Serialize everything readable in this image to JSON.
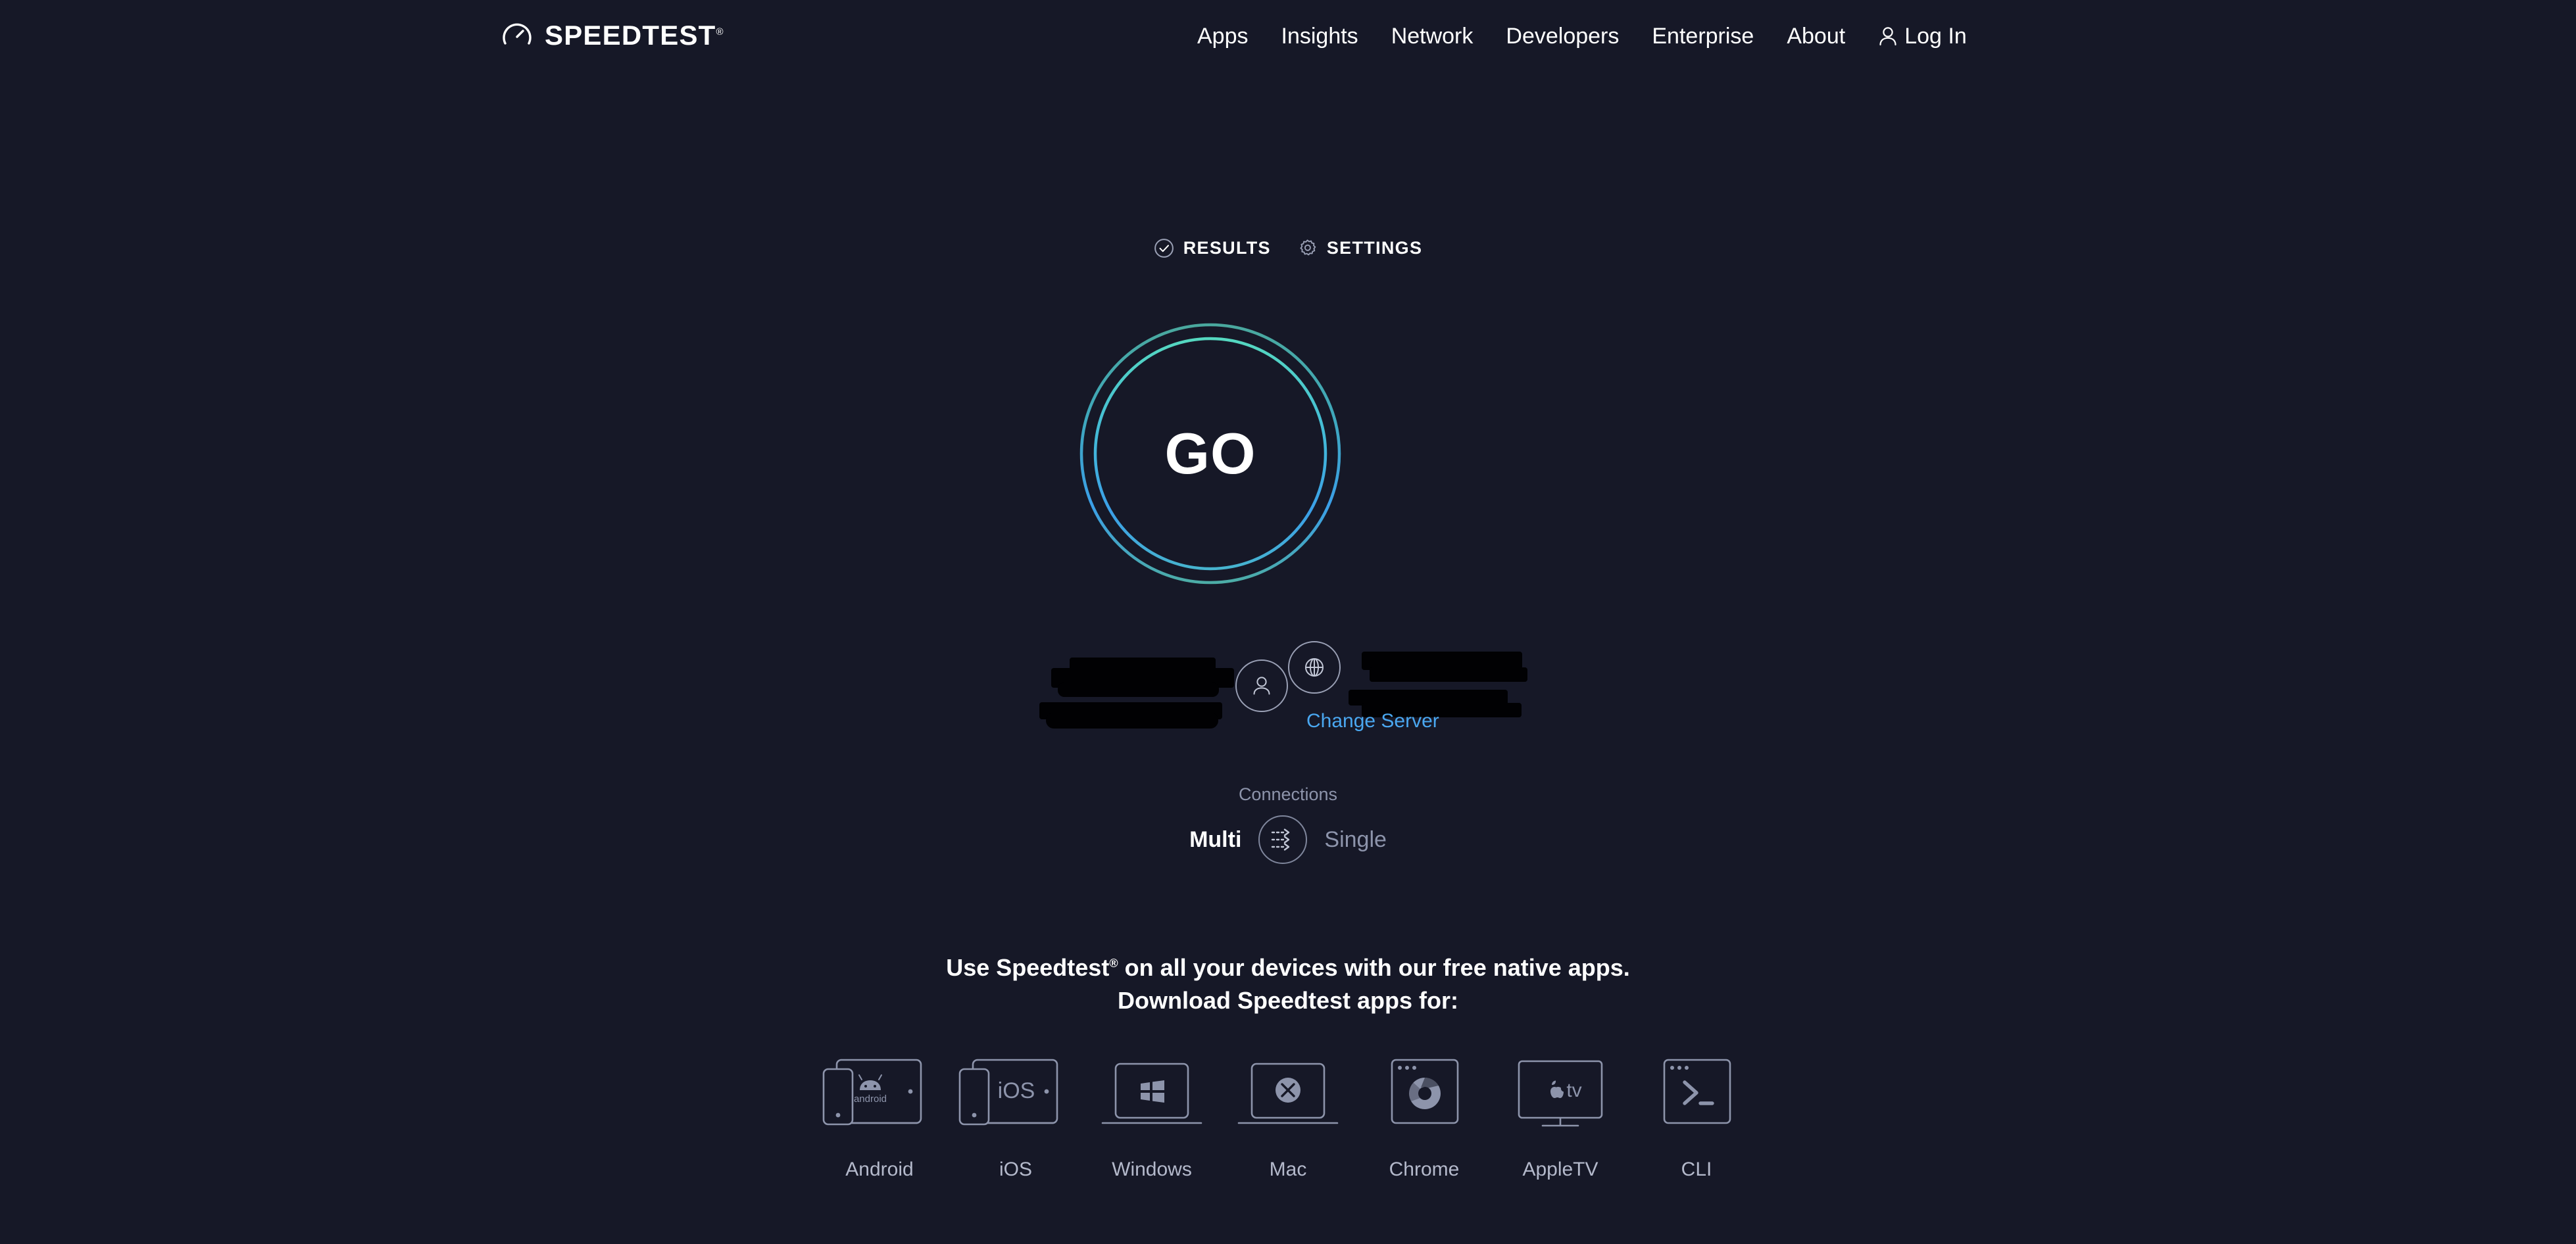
{
  "brand": {
    "logo_text": "SPEEDTEST",
    "logo_registered": "®",
    "logo_icon": "speedometer-icon"
  },
  "colors": {
    "background": "#161827",
    "ring_teal": "#55d8c0",
    "ring_blue": "#3b9fe8",
    "link_blue": "#4aa7f0",
    "muted_text": "#8d94ab",
    "icon_stroke": "#9aa0b5"
  },
  "nav": {
    "items": [
      {
        "label": "Apps"
      },
      {
        "label": "Insights"
      },
      {
        "label": "Network"
      },
      {
        "label": "Developers"
      },
      {
        "label": "Enterprise"
      },
      {
        "label": "About"
      }
    ],
    "login": {
      "label": "Log In",
      "icon": "user-icon"
    }
  },
  "tabs": [
    {
      "label": "RESULTS",
      "icon": "check-circle-icon"
    },
    {
      "label": "SETTINGS",
      "icon": "gear-icon"
    }
  ],
  "test": {
    "go_label": "GO"
  },
  "connection": {
    "isp": {
      "icon": "person-icon",
      "name_redacted": true
    },
    "server": {
      "icon": "globe-icon",
      "name_redacted": true
    },
    "change_server_label": "Change Server"
  },
  "connections": {
    "label": "Connections",
    "multi_label": "Multi",
    "single_label": "Single",
    "selected": "Multi",
    "toggle_icon": "multi-arrows-icon"
  },
  "promo": {
    "line1_prefix": "Use Speedtest",
    "line1_registered": "®",
    "line1_suffix": " on all your devices with our free native apps.",
    "line2": "Download Speedtest apps for:"
  },
  "platforms": [
    {
      "label": "Android",
      "icon": "android-devices-icon"
    },
    {
      "label": "iOS",
      "icon": "ios-devices-icon"
    },
    {
      "label": "Windows",
      "icon": "windows-laptop-icon"
    },
    {
      "label": "Mac",
      "icon": "mac-laptop-icon"
    },
    {
      "label": "Chrome",
      "icon": "chrome-browser-icon"
    },
    {
      "label": "AppleTV",
      "icon": "appletv-monitor-icon"
    },
    {
      "label": "CLI",
      "icon": "terminal-icon"
    }
  ]
}
